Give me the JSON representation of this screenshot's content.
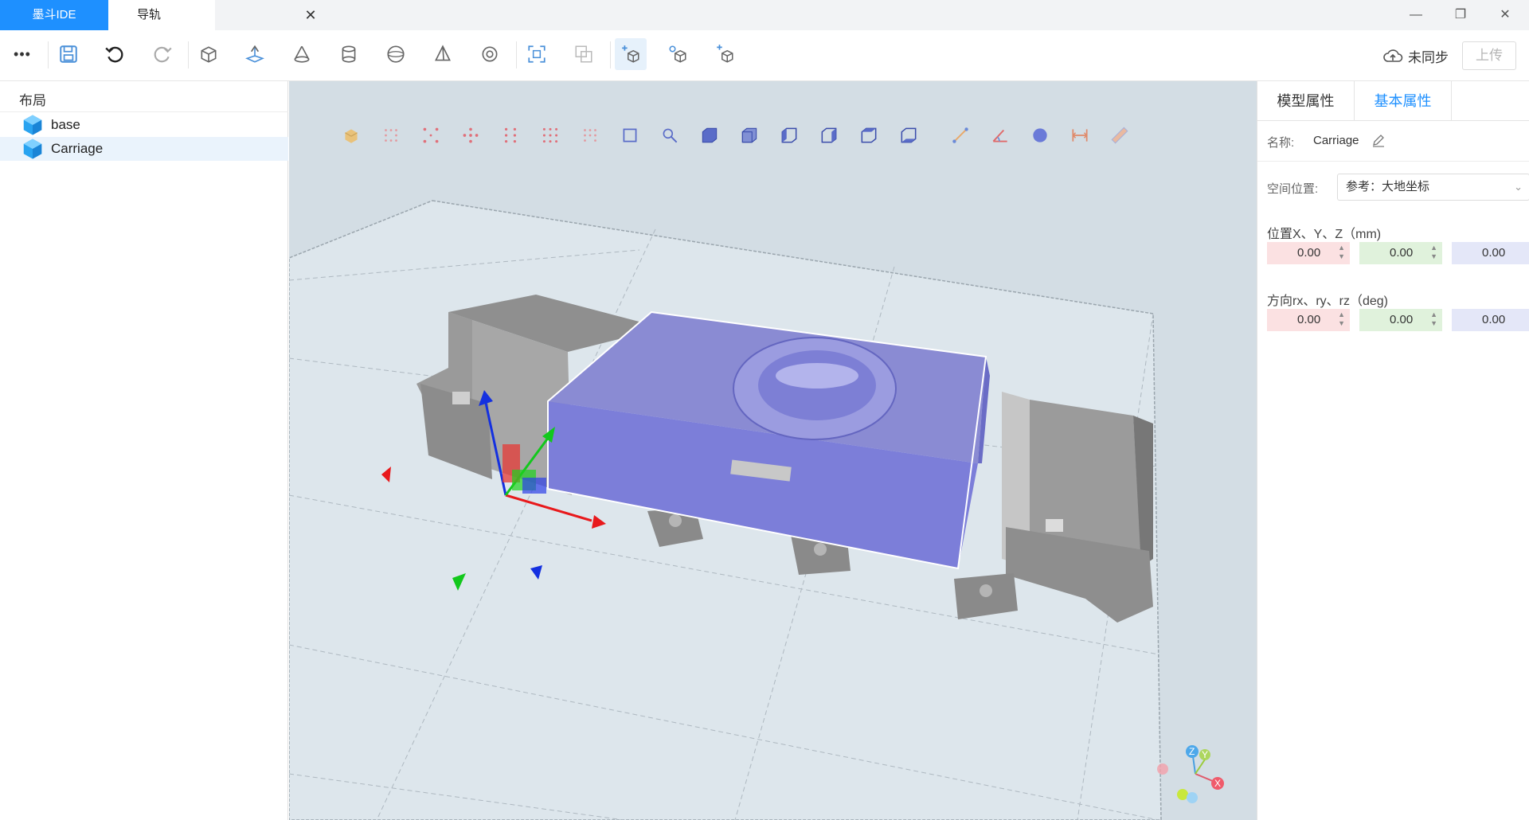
{
  "tabs": [
    {
      "label": "墨斗IDE"
    },
    {
      "label": "导轨"
    }
  ],
  "tab_close_glyph": "✕",
  "window_controls": {
    "minimize": "—",
    "maximize": "❐",
    "close": "✕"
  },
  "toolbar": {
    "more": "•••",
    "icons": [
      "save-icon",
      "undo-icon",
      "redo-icon",
      "box-icon",
      "plane-icon",
      "cone-icon",
      "cylinder-icon",
      "sphere-icon",
      "pyramid-icon",
      "torus-icon",
      "fit-view-icon",
      "boolean-icon",
      "add-part-icon",
      "add-joint-icon",
      "add-link-icon"
    ],
    "sync_status": "未同步",
    "upload_label": "上传"
  },
  "left_panel": {
    "title": "布局",
    "items": [
      {
        "label": "base",
        "selected": false
      },
      {
        "label": "Carriage",
        "selected": true
      }
    ]
  },
  "viewport_toolbar": {
    "icons": [
      "cube-solid-icon",
      "grid-points-icon",
      "grid-corners-icon",
      "grid-center-icon",
      "grid-edges-icon",
      "grid-full-icon",
      "grid-sparse-icon",
      "select-box-icon",
      "select-pick-icon",
      "view-front-icon",
      "view-back-icon",
      "view-left-icon",
      "view-right-icon",
      "view-top-icon",
      "view-bottom-icon",
      "measure-line-icon",
      "measure-angle-icon",
      "measure-sphere-icon",
      "measure-distance-icon",
      "ruler-icon"
    ]
  },
  "axis_gizmo": {
    "z": "Z",
    "y": "Y",
    "x": "X"
  },
  "right_panel": {
    "tabs": [
      {
        "label": "模型属性"
      },
      {
        "label": "基本属性",
        "active": true
      }
    ],
    "name_label": "名称:",
    "name_value": "Carriage",
    "space_label": "空间位置:",
    "reference_value": "参考：大地坐标",
    "position_label": "位置X、Y、Z（mm)",
    "position": [
      "0.00",
      "0.00",
      "0.00"
    ],
    "rotation_label": "方向rx、ry、rz（deg)",
    "rotation": [
      "0.00",
      "0.00",
      "0.00"
    ]
  },
  "colors": {
    "accent": "#1e90ff",
    "carriage": "#7c7ed9",
    "x_axis": "#e8191c",
    "y_axis": "#12c81c",
    "z_axis": "#1430e0"
  }
}
